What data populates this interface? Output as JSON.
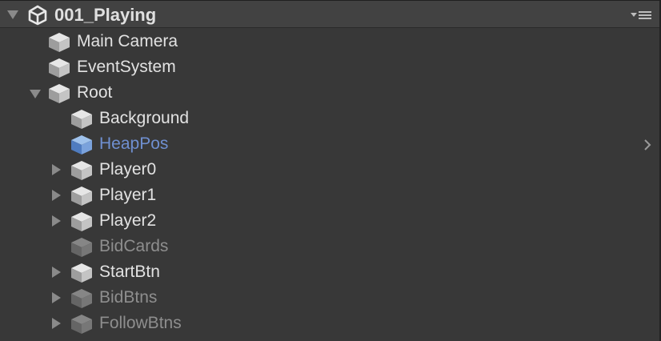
{
  "scene": {
    "title": "001_Playing",
    "icon": "unity-logo-icon",
    "menu_icon": "hamburger-menu-icon"
  },
  "items": [
    {
      "label": "Main Camera",
      "depth": 1,
      "has_children": false,
      "expanded": false,
      "state": "active"
    },
    {
      "label": "EventSystem",
      "depth": 1,
      "has_children": false,
      "expanded": false,
      "state": "active"
    },
    {
      "label": "Root",
      "depth": 1,
      "has_children": true,
      "expanded": true,
      "state": "active"
    },
    {
      "label": "Background",
      "depth": 2,
      "has_children": false,
      "expanded": false,
      "state": "active"
    },
    {
      "label": "HeapPos",
      "depth": 2,
      "has_children": false,
      "expanded": false,
      "state": "prefab",
      "trailing_icon": "chevron-right-icon"
    },
    {
      "label": "Player0",
      "depth": 2,
      "has_children": true,
      "expanded": false,
      "state": "active"
    },
    {
      "label": "Player1",
      "depth": 2,
      "has_children": true,
      "expanded": false,
      "state": "active"
    },
    {
      "label": "Player2",
      "depth": 2,
      "has_children": true,
      "expanded": false,
      "state": "active"
    },
    {
      "label": "BidCards",
      "depth": 2,
      "has_children": false,
      "expanded": false,
      "state": "inactive"
    },
    {
      "label": "StartBtn",
      "depth": 2,
      "has_children": true,
      "expanded": false,
      "state": "active"
    },
    {
      "label": "BidBtns",
      "depth": 2,
      "has_children": true,
      "expanded": false,
      "state": "inactive"
    },
    {
      "label": "FollowBtns",
      "depth": 2,
      "has_children": true,
      "expanded": false,
      "state": "inactive"
    }
  ],
  "colors": {
    "background": "#383838",
    "header": "#424242",
    "text": "#e2e2e2",
    "inactive_text": "#8e8e8e",
    "prefab_text": "#6f8fd0"
  }
}
